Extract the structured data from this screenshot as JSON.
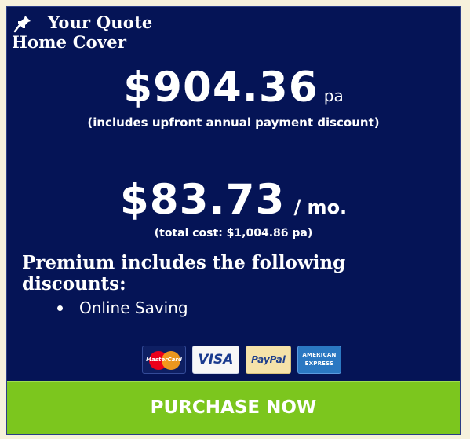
{
  "header": {
    "title_line1": "Your Quote",
    "title_line2": "Home Cover",
    "icon": "pin-icon"
  },
  "annual": {
    "amount": "$904.36",
    "unit": "pa",
    "note": "(includes upfront annual payment discount)"
  },
  "monthly": {
    "amount": "$83.73",
    "unit": "/ mo.",
    "note": "(total cost: $1,004.86 pa)"
  },
  "discounts": {
    "heading": "Premium includes the following discounts:",
    "items": [
      "Online Saving"
    ]
  },
  "payment_methods": {
    "mastercard": "MasterCard",
    "visa": "VISA",
    "paypal": "PayPal",
    "amex": "AMERICAN EXPRESS"
  },
  "actions": {
    "purchase_label": "PURCHASE NOW"
  },
  "colors": {
    "panel": "#051456",
    "page": "#f6f1dc",
    "button": "#7cc61e",
    "text": "#ffffff"
  }
}
